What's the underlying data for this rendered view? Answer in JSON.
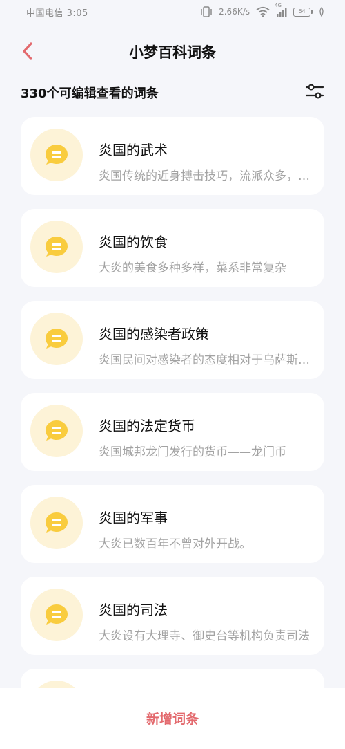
{
  "status_bar": {
    "carrier_time": "中国电信 3:05",
    "network_speed": "2.66K/s",
    "network_type": "4G",
    "battery": "64",
    "icons": [
      "vibrate-icon",
      "wifi-icon",
      "signal-icon",
      "battery-icon",
      "leaf-icon"
    ]
  },
  "header": {
    "title": "小梦百科词条",
    "back_icon": "chevron-left-icon"
  },
  "subheader": {
    "count_text": "330个可编辑查看的词条",
    "filter_icon": "filter-sliders-icon"
  },
  "entries": [
    {
      "title": "炎国的武术",
      "desc": "炎国传统的近身搏击技巧，流派众多，各有所长"
    },
    {
      "title": "炎国的饮食",
      "desc": "大炎的美食多种多样，菜系非常复杂"
    },
    {
      "title": "炎国的感染者政策",
      "desc": "炎国民间对感染者的态度相对于乌萨斯较为宽松"
    },
    {
      "title": "炎国的法定货币",
      "desc": "炎国城邦龙门发行的货币——龙门币"
    },
    {
      "title": "炎国的军事",
      "desc": "大炎已数百年不曾对外开战。"
    },
    {
      "title": "炎国的司法",
      "desc": "大炎设有大理寺、御史台等机构负责司法"
    },
    {
      "title": "",
      "desc": ""
    }
  ],
  "bottom": {
    "add_label": "新增词条"
  },
  "colors": {
    "accent": "#e36a6e",
    "icon_yellow": "#f9cc3e",
    "avatar_bg": "#fdf3d7",
    "page_bg": "#f5f6fa"
  }
}
